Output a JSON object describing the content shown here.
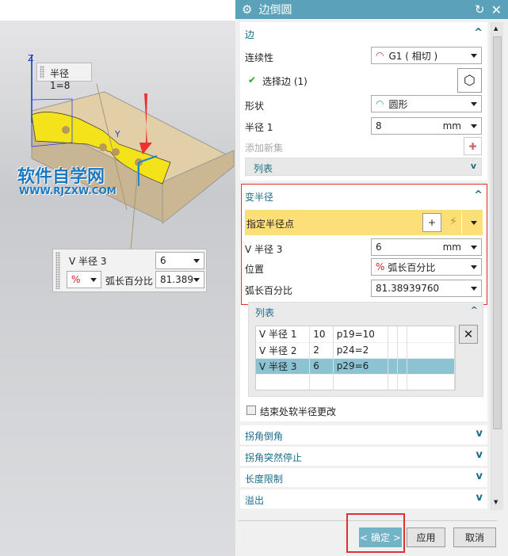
{
  "viewport": {
    "radius_tag": "半径 1=8",
    "axis_z": "Z",
    "axis_y": "Y",
    "watermark": "软件自学网",
    "watermark_url": "WWW.RJZXW.COM",
    "popup": {
      "label": "V 半径 3",
      "value": "6",
      "position_label": "弧长百分比",
      "position_value": "81.389",
      "position_icon": "%"
    }
  },
  "dialog": {
    "title": "边倒圆",
    "edge": {
      "header": "边",
      "continuity_label": "连续性",
      "continuity_value": "G1 ( 相切 )",
      "select_edge": "选择边 (1)",
      "shape_label": "形状",
      "shape_value": "圆形",
      "radius_label": "半径 1",
      "radius_value": "8",
      "radius_unit": "mm",
      "add_set": "添加新集",
      "list_header": "列表"
    },
    "variable": {
      "header": "变半径",
      "specify_point": "指定半径点",
      "v_radius_label": "V 半径 3",
      "v_radius_value": "6",
      "v_radius_unit": "mm",
      "position_label": "位置",
      "position_value": "弧长百分比",
      "arc_label": "弧长百分比",
      "arc_value": "81.38939760",
      "list_header": "列表",
      "rows": [
        {
          "name": "V 半径 1",
          "value": "10",
          "expr": "p19=10"
        },
        {
          "name": "V 半径 2",
          "value": "2",
          "expr": "p24=2"
        },
        {
          "name": "V 半径 3",
          "value": "6",
          "expr": "p29=6"
        }
      ],
      "soft_change": "结束处软半径更改"
    },
    "collapsed": [
      "拐角倒角",
      "拐角突然停止",
      "长度限制",
      "溢出"
    ],
    "ok": "< 确定 >",
    "apply": "应用",
    "cancel": "取消",
    "accent": "#5aa1b9",
    "highlight": "#fddf7a",
    "selected_row": "#8cc3d3"
  }
}
